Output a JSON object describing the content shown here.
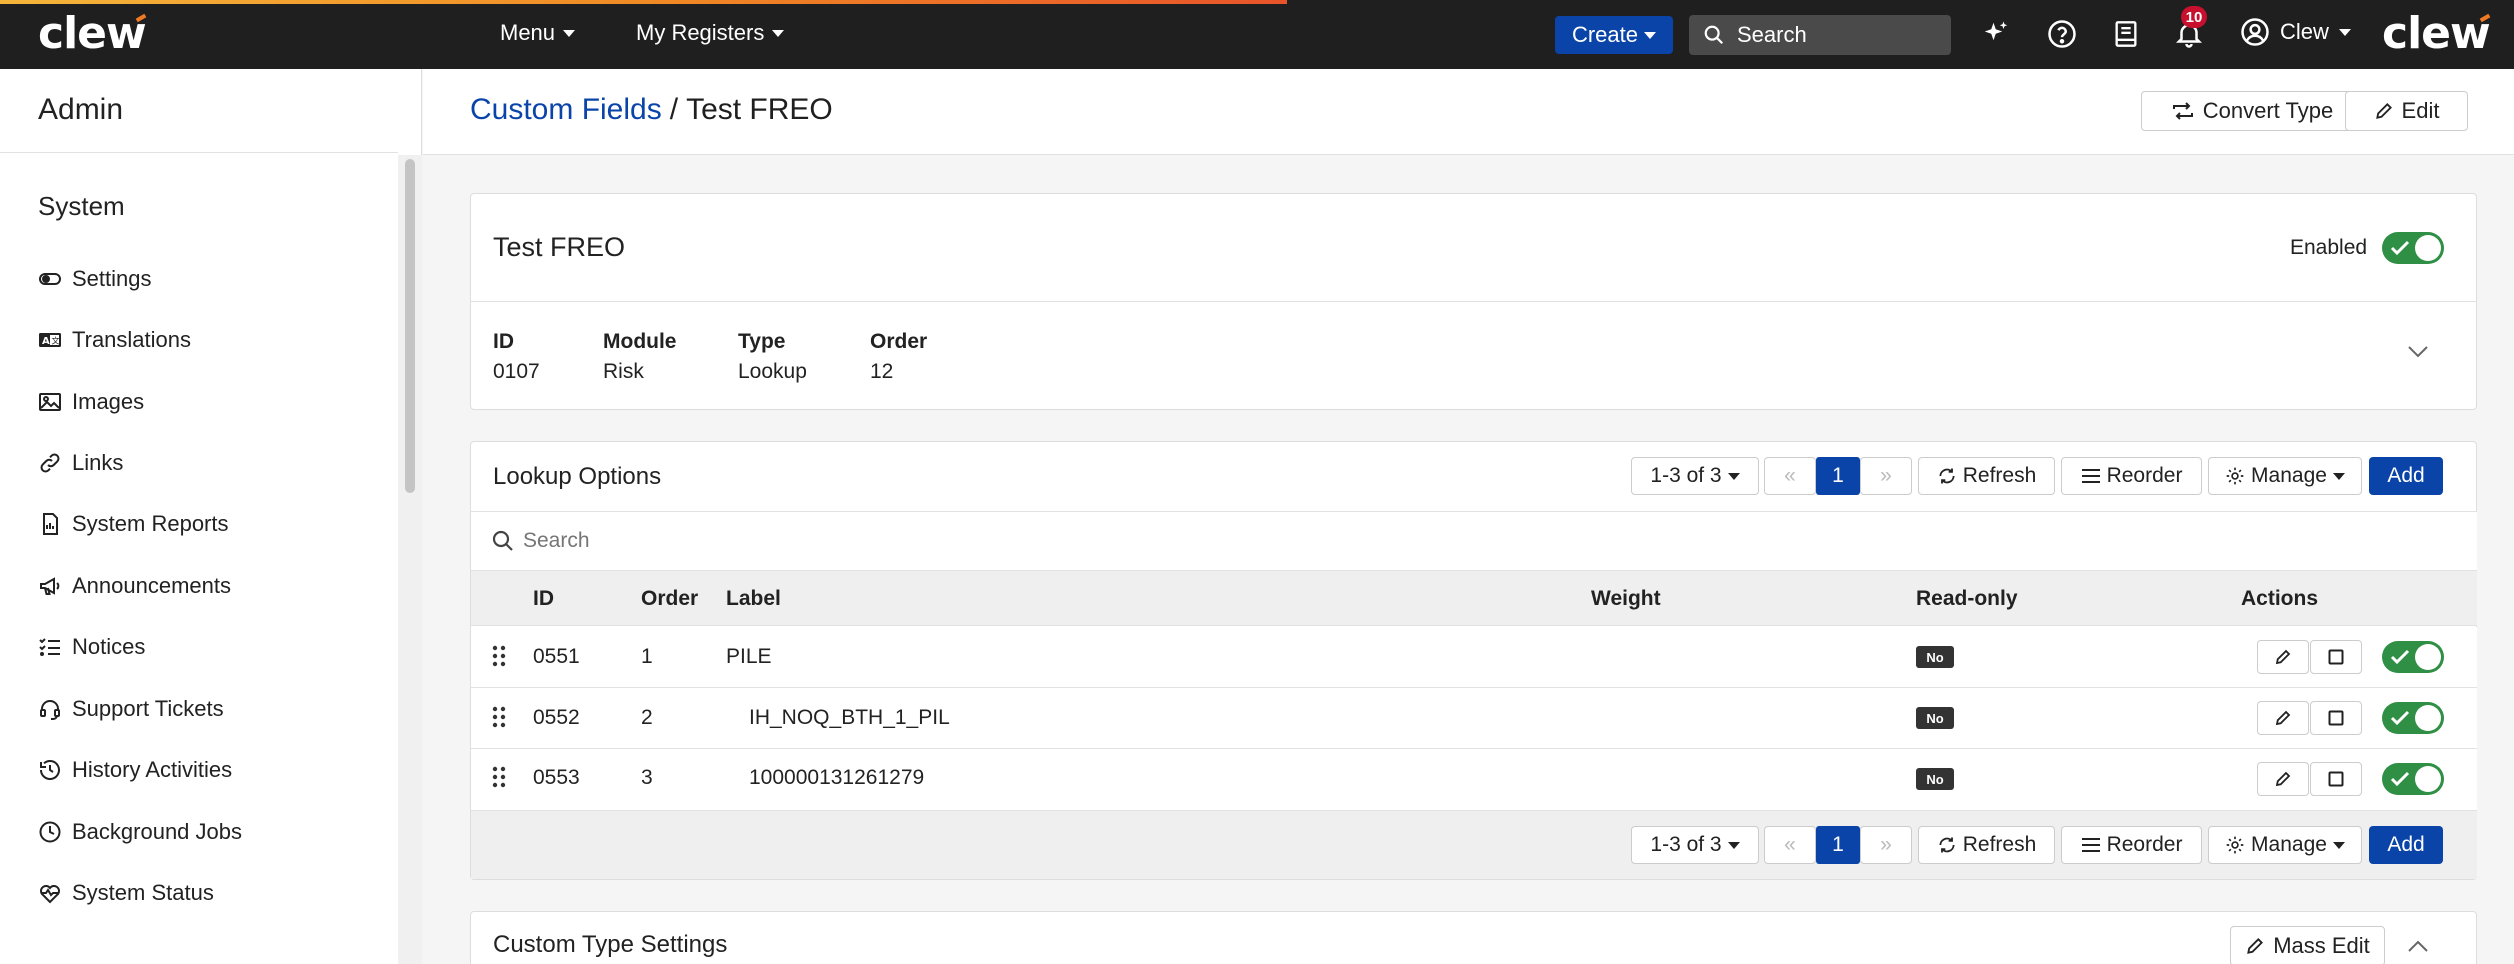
{
  "app": {
    "logo_text": "clew",
    "accent_color": "#0b44a8",
    "success_color": "#2f8f45"
  },
  "topnav": {
    "menu_label": "Menu",
    "registers_label": "My Registers",
    "create_label": "Create",
    "search_label": "Search",
    "notification_count": "10",
    "user_label": "Clew",
    "icons": [
      "sparkle-icon",
      "help-icon",
      "book-icon",
      "bell-icon",
      "user-circle-icon"
    ]
  },
  "sidebar": {
    "title": "Admin",
    "section": "System",
    "items": [
      {
        "label": "Settings",
        "icon": "toggle-icon"
      },
      {
        "label": "Translations",
        "icon": "translate-icon"
      },
      {
        "label": "Images",
        "icon": "image-icon"
      },
      {
        "label": "Links",
        "icon": "link-icon"
      },
      {
        "label": "System Reports",
        "icon": "report-icon"
      },
      {
        "label": "Announcements",
        "icon": "megaphone-icon"
      },
      {
        "label": "Notices",
        "icon": "list-check-icon"
      },
      {
        "label": "Support Tickets",
        "icon": "headset-icon"
      },
      {
        "label": "History Activities",
        "icon": "history-icon"
      },
      {
        "label": "Background Jobs",
        "icon": "clock-icon"
      },
      {
        "label": "System Status",
        "icon": "heartbeat-icon"
      }
    ]
  },
  "page": {
    "breadcrumb_link": "Custom Fields",
    "breadcrumb_sep": "/",
    "breadcrumb_current": "Test FREO",
    "convert_label": "Convert Type",
    "edit_label": "Edit"
  },
  "field": {
    "title": "Test FREO",
    "enabled_label": "Enabled",
    "enabled": true,
    "meta": [
      {
        "label": "ID",
        "value": "0107"
      },
      {
        "label": "Module",
        "value": "Risk"
      },
      {
        "label": "Type",
        "value": "Lookup"
      },
      {
        "label": "Order",
        "value": "12"
      }
    ]
  },
  "lookup": {
    "title": "Lookup Options",
    "range_label": "1-3 of 3",
    "current_page": "1",
    "refresh_label": "Refresh",
    "reorder_label": "Reorder",
    "manage_label": "Manage",
    "add_label": "Add",
    "search_placeholder": "Search",
    "columns": [
      "ID",
      "Order",
      "Label",
      "Weight",
      "Read-only",
      "Actions"
    ],
    "rows": [
      {
        "id": "0551",
        "order": "1",
        "label": "PILE",
        "weight": "",
        "readonly": "No",
        "enabled": true
      },
      {
        "id": "0552",
        "order": "2",
        "label": "IH_NOQ_BTH_1_PIL",
        "weight": "",
        "readonly": "No",
        "enabled": true
      },
      {
        "id": "0553",
        "order": "3",
        "label": "100000131261279",
        "weight": "",
        "readonly": "No",
        "enabled": true
      }
    ]
  },
  "type_settings": {
    "title": "Custom Type Settings",
    "mass_edit_label": "Mass Edit"
  }
}
